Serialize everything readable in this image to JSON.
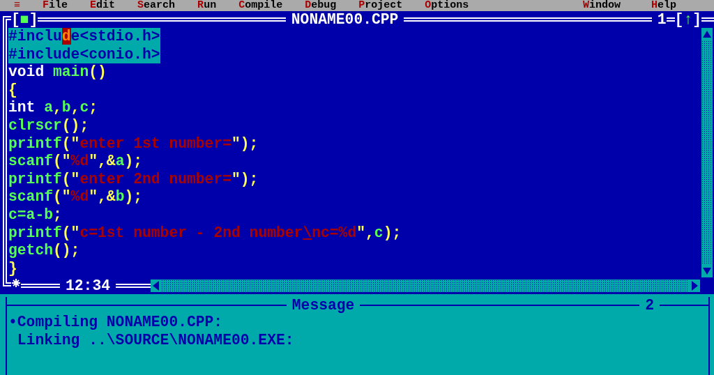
{
  "menu": [
    {
      "label": "≡"
    },
    {
      "label": "File"
    },
    {
      "label": "Edit"
    },
    {
      "label": "Search"
    },
    {
      "label": "Run"
    },
    {
      "label": "Compile"
    },
    {
      "label": "Debug"
    },
    {
      "label": "Project"
    },
    {
      "label": "Options"
    }
  ],
  "menu_right": [
    {
      "label": "Window"
    },
    {
      "label": "Help"
    }
  ],
  "editor": {
    "title": "NONAME00.CPP",
    "close_button": "[■]",
    "window_number": "1",
    "zoom_button": "[↑]",
    "position": "12:34",
    "lines": [
      {
        "selected": true,
        "tokens": [
          {
            "kind": "plain",
            "text": "#inclu"
          },
          {
            "kind": "cursor",
            "text": "d"
          },
          {
            "kind": "plain",
            "text": "e<stdio.h>"
          }
        ]
      },
      {
        "selected": true,
        "tokens": [
          {
            "kind": "plain",
            "text": "#include<conio.h>"
          }
        ]
      },
      {
        "selected": false,
        "tokens": [
          {
            "kind": "keyword",
            "text": "void "
          },
          {
            "kind": "ident",
            "text": "main"
          },
          {
            "kind": "punct",
            "text": "()"
          }
        ]
      },
      {
        "selected": false,
        "tokens": [
          {
            "kind": "punct",
            "text": "{"
          }
        ]
      },
      {
        "selected": false,
        "tokens": [
          {
            "kind": "keyword",
            "text": "int "
          },
          {
            "kind": "ident",
            "text": "a"
          },
          {
            "kind": "punct",
            "text": ","
          },
          {
            "kind": "ident",
            "text": "b"
          },
          {
            "kind": "punct",
            "text": ","
          },
          {
            "kind": "ident",
            "text": "c"
          },
          {
            "kind": "punct",
            "text": ";"
          }
        ]
      },
      {
        "selected": false,
        "tokens": [
          {
            "kind": "ident",
            "text": "clrscr"
          },
          {
            "kind": "punct",
            "text": "();"
          }
        ]
      },
      {
        "selected": false,
        "tokens": [
          {
            "kind": "ident",
            "text": "printf"
          },
          {
            "kind": "punct",
            "text": "(\""
          },
          {
            "kind": "string",
            "text": "enter 1st number="
          },
          {
            "kind": "punct",
            "text": "\");"
          }
        ]
      },
      {
        "selected": false,
        "tokens": [
          {
            "kind": "ident",
            "text": "scanf"
          },
          {
            "kind": "punct",
            "text": "(\""
          },
          {
            "kind": "string",
            "text": "%d"
          },
          {
            "kind": "punct",
            "text": "\",&"
          },
          {
            "kind": "ident",
            "text": "a"
          },
          {
            "kind": "punct",
            "text": ");"
          }
        ]
      },
      {
        "selected": false,
        "tokens": [
          {
            "kind": "ident",
            "text": "printf"
          },
          {
            "kind": "punct",
            "text": "(\""
          },
          {
            "kind": "string",
            "text": "enter 2nd number="
          },
          {
            "kind": "punct",
            "text": "\");"
          }
        ]
      },
      {
        "selected": false,
        "tokens": [
          {
            "kind": "ident",
            "text": "scanf"
          },
          {
            "kind": "punct",
            "text": "(\""
          },
          {
            "kind": "string",
            "text": "%d"
          },
          {
            "kind": "punct",
            "text": "\",&"
          },
          {
            "kind": "ident",
            "text": "b"
          },
          {
            "kind": "punct",
            "text": ");"
          }
        ]
      },
      {
        "selected": false,
        "tokens": [
          {
            "kind": "ident",
            "text": "c=a-b"
          },
          {
            "kind": "punct",
            "text": ";"
          }
        ]
      },
      {
        "selected": false,
        "tokens": [
          {
            "kind": "ident",
            "text": "printf"
          },
          {
            "kind": "punct",
            "text": "(\""
          },
          {
            "kind": "string",
            "text": "c=1st number - 2nd number"
          },
          {
            "kind": "escape",
            "text": "\\"
          },
          {
            "kind": "string",
            "text": "nc=%d"
          },
          {
            "kind": "punct",
            "text": "\","
          },
          {
            "kind": "ident",
            "text": "c"
          },
          {
            "kind": "punct",
            "text": ");"
          }
        ]
      },
      {
        "selected": false,
        "tokens": [
          {
            "kind": "ident",
            "text": "getch"
          },
          {
            "kind": "punct",
            "text": "();"
          }
        ]
      },
      {
        "selected": false,
        "tokens": [
          {
            "kind": "punct",
            "text": "}"
          }
        ]
      }
    ]
  },
  "message_window": {
    "title": "Message",
    "window_number": "2",
    "lines": [
      {
        "marker": "•",
        "text": "Compiling NONAME00.CPP:"
      },
      {
        "text": "Linking ..\\SOURCE\\NONAME00.EXE:"
      }
    ]
  }
}
